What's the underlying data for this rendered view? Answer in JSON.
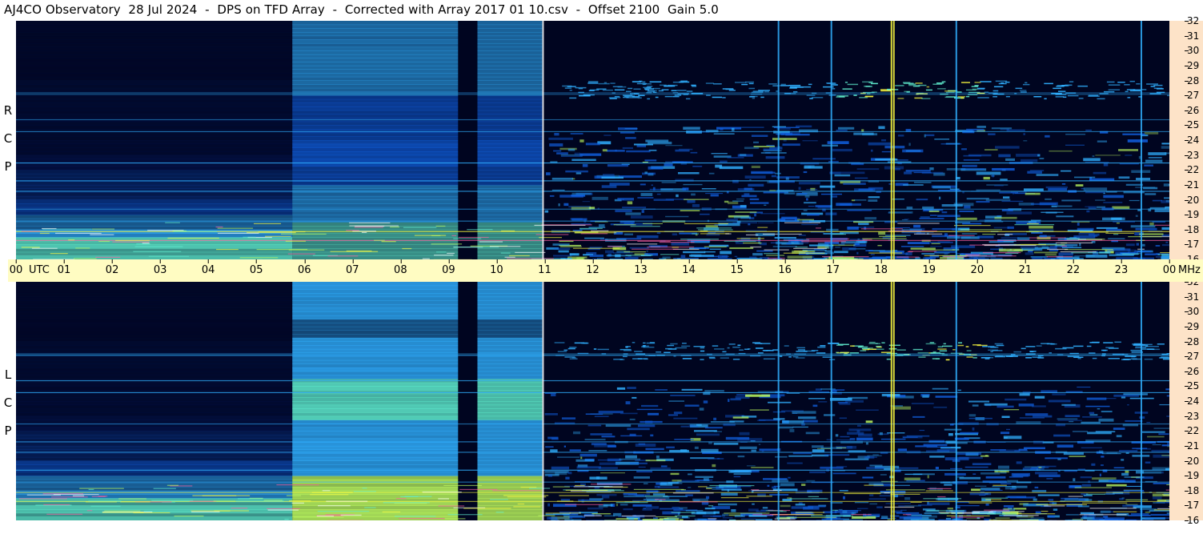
{
  "header": {
    "title": "AJ4CO Observatory  28 Jul 2024  -  DPS on TFD Array  -  Corrected with Array 2017 01 10.csv  -  Offset 2100  Gain 5.0"
  },
  "panels": {
    "top": {
      "polarization": [
        "R",
        "C",
        "P"
      ]
    },
    "bottom": {
      "polarization": [
        "L",
        "C",
        "P"
      ]
    }
  },
  "axes": {
    "time_unit": "UTC",
    "freq_unit": "MHz",
    "time_ticks": [
      "00",
      "01",
      "02",
      "03",
      "04",
      "05",
      "06",
      "07",
      "08",
      "09",
      "10",
      "11",
      "12",
      "13",
      "14",
      "15",
      "16",
      "17",
      "18",
      "19",
      "20",
      "21",
      "22",
      "23",
      "00"
    ],
    "freq_ticks": [
      "32",
      "31",
      "30",
      "29",
      "28",
      "27",
      "26",
      "25",
      "24",
      "23",
      "22",
      "21",
      "20",
      "19",
      "18",
      "17",
      "16"
    ]
  },
  "colors": {
    "background": "#000520",
    "freq_axis_bg": "#fde3c8",
    "time_axis_bg": "#fffcc2"
  },
  "chart_data": [
    {
      "type": "heatmap",
      "panel": "RCP",
      "xlabel": "UTC",
      "ylabel": "MHz",
      "xlim": [
        0,
        24
      ],
      "ylim": [
        16,
        32
      ],
      "colormap": [
        "#000520",
        "#0a2a8a",
        "#1060e0",
        "#30b0ff",
        "#60f0d0",
        "#c0ff60",
        "#ffff40",
        "#ff60a0",
        "#ffffff"
      ]
    },
    {
      "type": "heatmap",
      "panel": "LCP",
      "xlabel": "UTC",
      "ylabel": "MHz",
      "xlim": [
        0,
        24
      ],
      "ylim": [
        16,
        32
      ],
      "colormap": [
        "#000520",
        "#0a2a8a",
        "#1060e0",
        "#30b0ff",
        "#60f0d0",
        "#c0ff60",
        "#ffff40",
        "#ff60a0",
        "#ffffff"
      ]
    }
  ]
}
